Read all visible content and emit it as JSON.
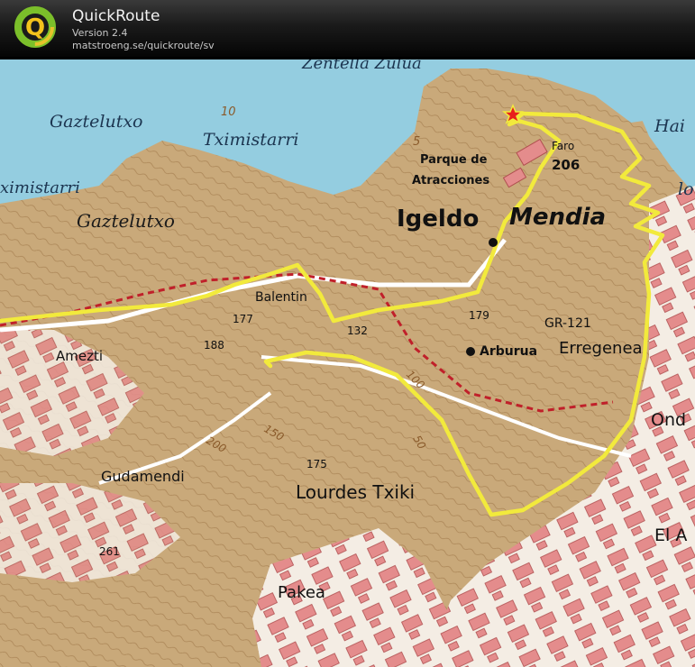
{
  "app": {
    "title": "QuickRoute",
    "version": "Version 2.4",
    "url": "matstroeng.se/quickroute/sv",
    "logo_letter": "Q"
  },
  "map": {
    "place_labels": {
      "zentella": "Zentella Zulua",
      "gaztelutxo_sea": "Gaztelutxo",
      "tximistarri_sea": "Tximistarri",
      "tximistarri_cut": "ximistarri",
      "gaztelutxo_land": "Gaztelutxo",
      "hai_cut": "Hai",
      "lo_cut": "lo",
      "igeldo": "Igeldo",
      "mendia": "Mendia",
      "parque_line1": "Parque de",
      "parque_line2": "Atracciones",
      "faro": "Faro",
      "balentin": "Balentin",
      "amezti": "Amezti",
      "arburua": "Arburua",
      "erregenea": "Erregenea",
      "gr121": "GR-121",
      "ond_cut": "Ond",
      "gudamendi": "Gudamendi",
      "lourdes": "Lourdes Txiki",
      "el_cut": "El A",
      "pakea": "Pakea"
    },
    "spot_heights": {
      "faro": "206",
      "h177": "177",
      "h188": "188",
      "h132": "132",
      "h179": "179",
      "h175": "175",
      "h261": "261"
    },
    "contour_labels": {
      "c10": "10",
      "c5": "5",
      "c100": "100",
      "c150": "150",
      "c200": "200",
      "c50": "50"
    },
    "colors": {
      "sea": "#94cde0",
      "terrain": "#c9a97a",
      "route": "#f2ea3c",
      "road_white": "#ffffff",
      "trail_red": "#c0202a",
      "building": "#e48c8c",
      "start_marker": "#e8201c"
    }
  }
}
